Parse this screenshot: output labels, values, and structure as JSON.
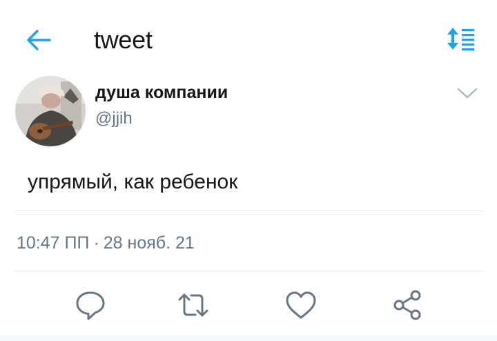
{
  "header": {
    "title": "tweet",
    "back_icon": "arrow-left-icon",
    "sort_icon": "sort-list-icon",
    "accent_color": "#1da1f2"
  },
  "tweet": {
    "author_name": "душа компании",
    "author_handle": "@jjih",
    "text": "упрямый, как ребенок",
    "time": "10:47 ПП",
    "separator": "·",
    "date": "28 нояб. 21"
  },
  "actions": [
    {
      "icon": "reply-icon"
    },
    {
      "icon": "retweet-icon"
    },
    {
      "icon": "like-icon"
    },
    {
      "icon": "share-icon"
    }
  ],
  "colors": {
    "primary_text": "#14171a",
    "secondary_text": "#657786",
    "divider": "#e1e8ed",
    "icon": "#657786"
  }
}
